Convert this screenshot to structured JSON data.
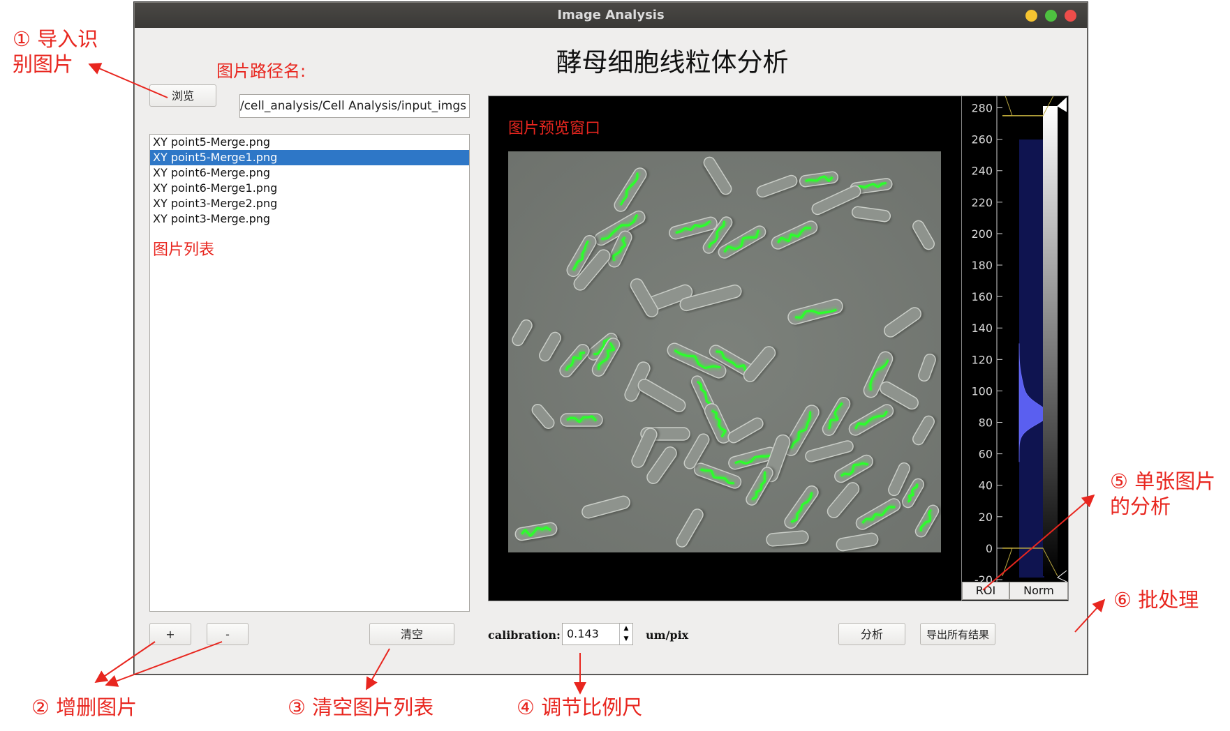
{
  "window": {
    "title": "Image Analysis",
    "heading": "酵母细胞线粒体分析"
  },
  "path": {
    "label": "图片路径名:",
    "browse_label": "浏览",
    "value": "hogn/cell_analysis/Cell Analysis/input_imgs"
  },
  "file_list": {
    "label": "图片列表",
    "items": [
      {
        "name": "XY point5-Merge.png",
        "selected": false
      },
      {
        "name": "XY point5-Merge1.png",
        "selected": true
      },
      {
        "name": "XY point6-Merge.png",
        "selected": false
      },
      {
        "name": "XY point6-Merge1.png",
        "selected": false
      },
      {
        "name": "XY point3-Merge2.png",
        "selected": false
      },
      {
        "name": "XY point3-Merge.png",
        "selected": false
      }
    ]
  },
  "preview": {
    "label": "图片预览窗口"
  },
  "histogram": {
    "ticks": [
      "280",
      "260",
      "240",
      "220",
      "200",
      "180",
      "160",
      "140",
      "120",
      "100",
      "80",
      "60",
      "40",
      "20",
      "0",
      "-20"
    ],
    "roi_label": "ROI",
    "norm_label": "Norm",
    "level_max": 275,
    "level_min": 0
  },
  "controls": {
    "add_label": "+",
    "remove_label": "-",
    "clear_label": "清空",
    "calibration_label": "calibration:",
    "calibration_value": "0.143",
    "unit_label": "um/pix",
    "analyze_label": "分析",
    "export_label": "导出所有结果"
  },
  "annotations": {
    "a1_line1": "① 导入识",
    "a1_line2": "别图片",
    "a2": "② 增删图片",
    "a3": "③ 清空图片列表",
    "a4": "④ 调节比例尺",
    "a5_line1": "⑤ 单张图片",
    "a5_line2": "的分析",
    "a6": "⑥ 批处理"
  },
  "colors": {
    "annotation_red": "#e8261f",
    "selection_blue": "#2e77c7",
    "histogram_fill": "#4a4fd6",
    "mito_green": "#2bff2b"
  }
}
